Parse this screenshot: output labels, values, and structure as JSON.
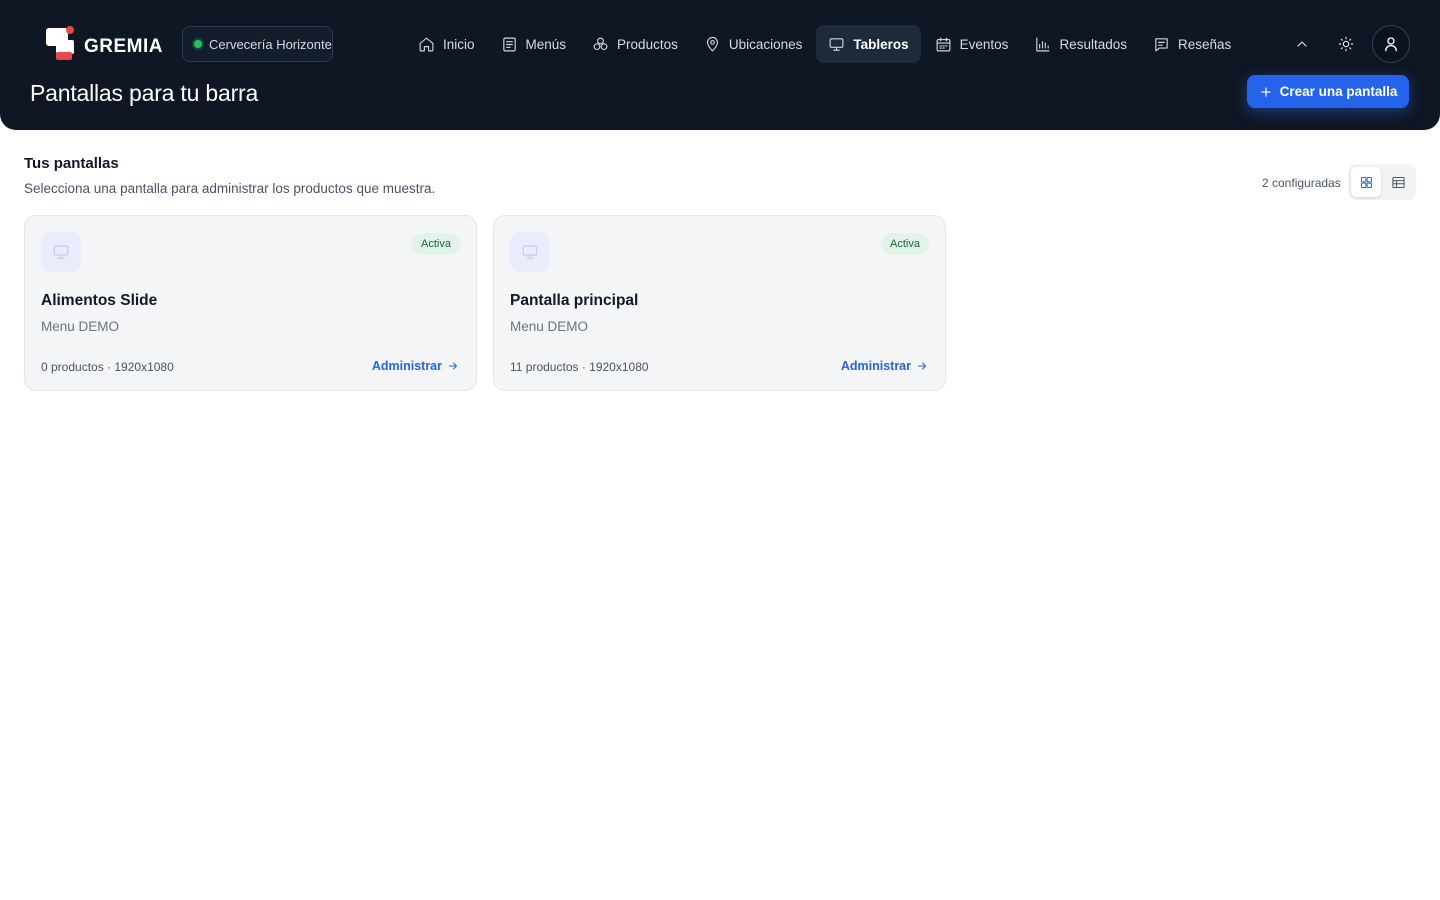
{
  "app": {
    "brand": "GREMIA",
    "organization": "Cervecería Horizonte",
    "page_title": "Pantallas para tu barra"
  },
  "nav": {
    "items": [
      {
        "label": "Inicio",
        "icon": "home-icon"
      },
      {
        "label": "Menús",
        "icon": "menu-doc-icon"
      },
      {
        "label": "Productos",
        "icon": "products-icon"
      },
      {
        "label": "Ubicaciones",
        "icon": "map-pin-icon"
      },
      {
        "label": "Tableros",
        "icon": "monitor-icon",
        "active": true
      },
      {
        "label": "Eventos",
        "icon": "calendar-icon"
      },
      {
        "label": "Resultados",
        "icon": "bar-chart-icon"
      },
      {
        "label": "Reseñas",
        "icon": "review-icon"
      }
    ]
  },
  "actions": {
    "create_label": "Crear una pantalla"
  },
  "section": {
    "title": "Tus pantallas",
    "subtitle": "Selecciona una pantalla para administrar los productos que muestra.",
    "count_label": "2 configuradas"
  },
  "screens": [
    {
      "name": "Alimentos Slide",
      "menu": "Menu DEMO",
      "status": "Activa",
      "meta": "0 productos · 1920x1080",
      "action": "Administrar"
    },
    {
      "name": "Pantalla principal",
      "menu": "Menu DEMO",
      "status": "Activa",
      "meta": "11 productos · 1920x1080",
      "action": "Administrar"
    }
  ],
  "colors": {
    "header_bg": "#0f1724",
    "accent": "#2563eb",
    "status_active_bg": "#e4f3ea",
    "status_active_text": "#166534"
  }
}
